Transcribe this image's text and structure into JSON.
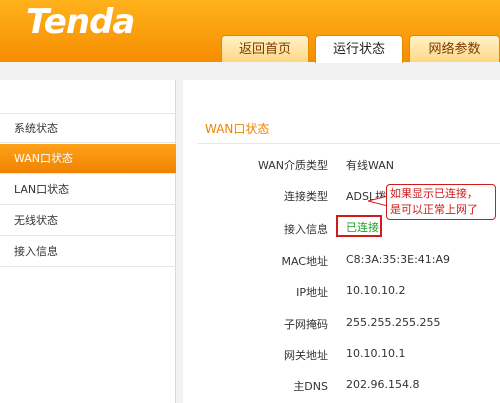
{
  "brand": {
    "logo_text": "Tenda"
  },
  "tabs": [
    {
      "label": "返回首页"
    },
    {
      "label": "运行状态",
      "active": true
    },
    {
      "label": "网络参数"
    }
  ],
  "sidebar": {
    "items": [
      {
        "label": "系统状态"
      },
      {
        "label": "WAN口状态",
        "active": true
      },
      {
        "label": "LAN口状态"
      },
      {
        "label": "无线状态"
      },
      {
        "label": "接入信息"
      }
    ]
  },
  "panel": {
    "title": "WAN口状态",
    "rows": [
      {
        "label": "WAN介质类型",
        "value": "有线WAN"
      },
      {
        "label": "连接类型",
        "value": "ADSL拨号"
      },
      {
        "label": "接入信息",
        "value": "已连接"
      },
      {
        "label": "MAC地址",
        "value": "C8:3A:35:3E:41:A9"
      },
      {
        "label": "IP地址",
        "value": "10.10.10.2"
      },
      {
        "label": "子网掩码",
        "value": "255.255.255.255"
      },
      {
        "label": "网关地址",
        "value": "10.10.10.1"
      },
      {
        "label": "主DNS",
        "value": "202.96.154.8"
      }
    ]
  },
  "annotation": {
    "line1": "如果显示已连接，",
    "line2": "是可以正常上网了"
  },
  "colors": {
    "brand_orange": "#f68d00",
    "status_green": "#1e9e1e",
    "annotation_red": "#d11a1a"
  }
}
